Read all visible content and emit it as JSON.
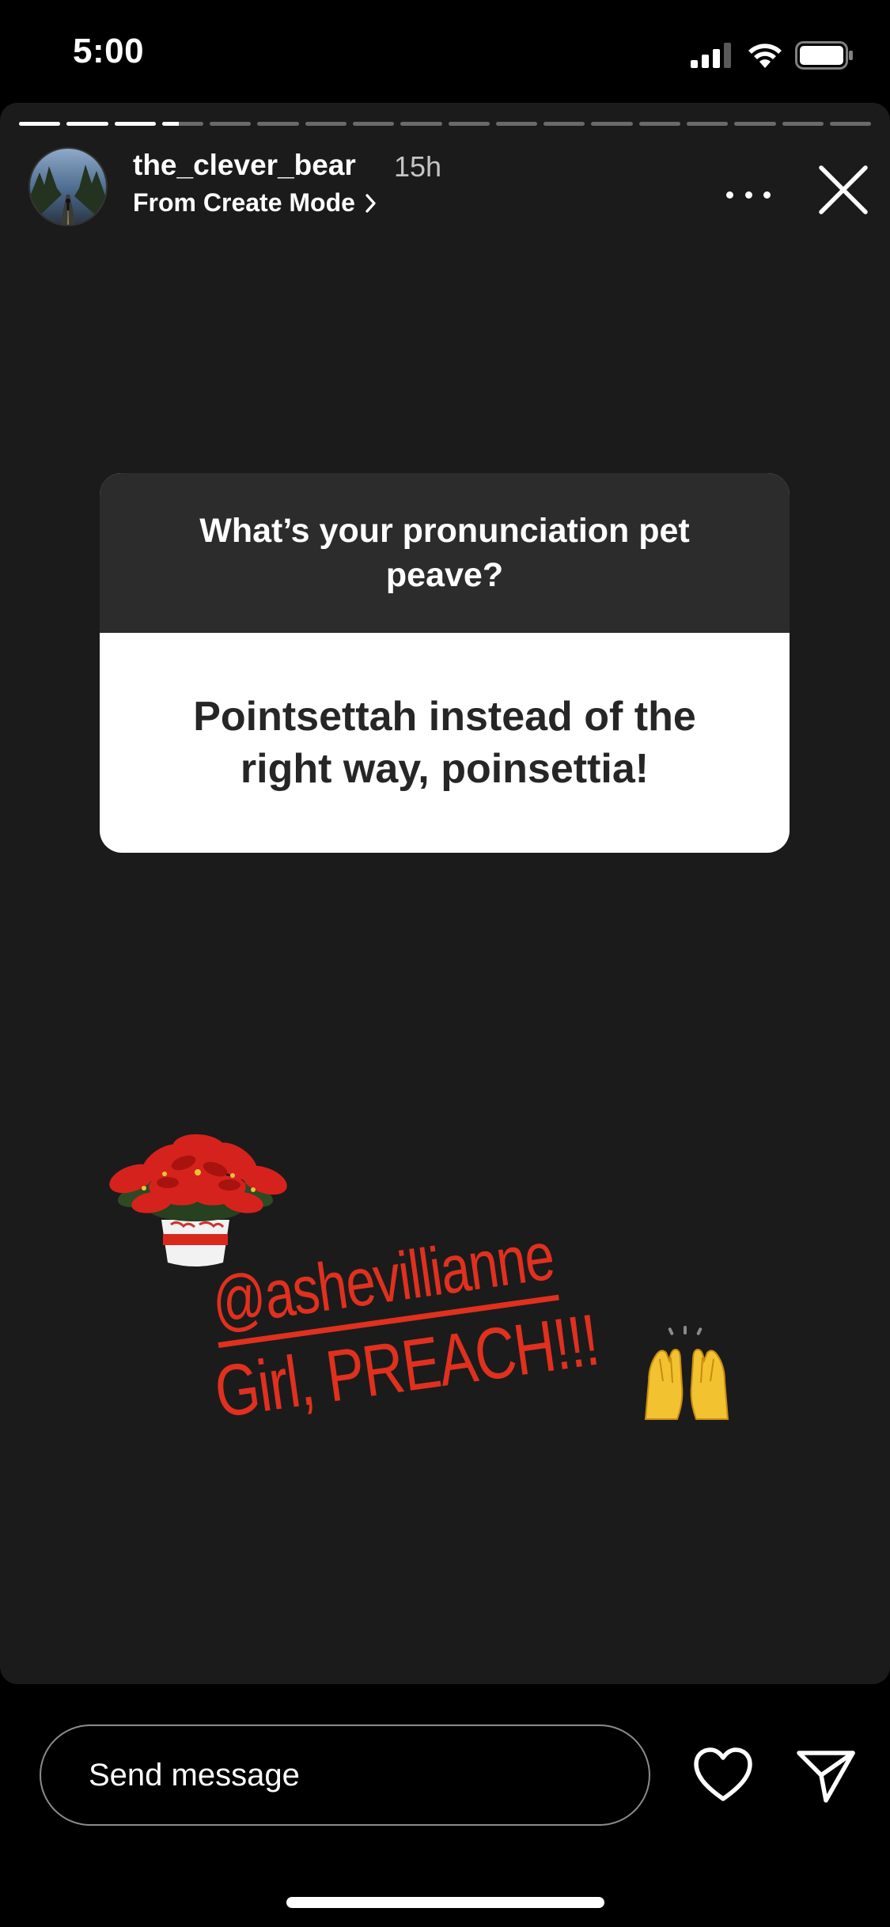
{
  "status_bar": {
    "time": "5:00",
    "icons": [
      "signal-icon",
      "wifi-icon",
      "battery-icon"
    ]
  },
  "story": {
    "progress": {
      "segments": 18,
      "completed": 3,
      "current_fraction": 0.4
    },
    "user": {
      "username": "the_clever_bear",
      "time_ago": "15h",
      "subtitle": "From Create Mode"
    },
    "question": {
      "prompt": "What’s your pronunciation pet peave?",
      "answer": "Pointsettah instead of the right way, poinsettia!"
    },
    "mention": {
      "handle": "@ashevillianne",
      "message": "Girl, PREACH!!!",
      "color": "#e0301e"
    }
  },
  "footer": {
    "message_placeholder": "Send message"
  },
  "colors": {
    "background": "#000000",
    "story_background": "#1b1b1b",
    "question_header": "#2c2c2c",
    "answer_background": "#ffffff",
    "answer_text": "#262626"
  }
}
